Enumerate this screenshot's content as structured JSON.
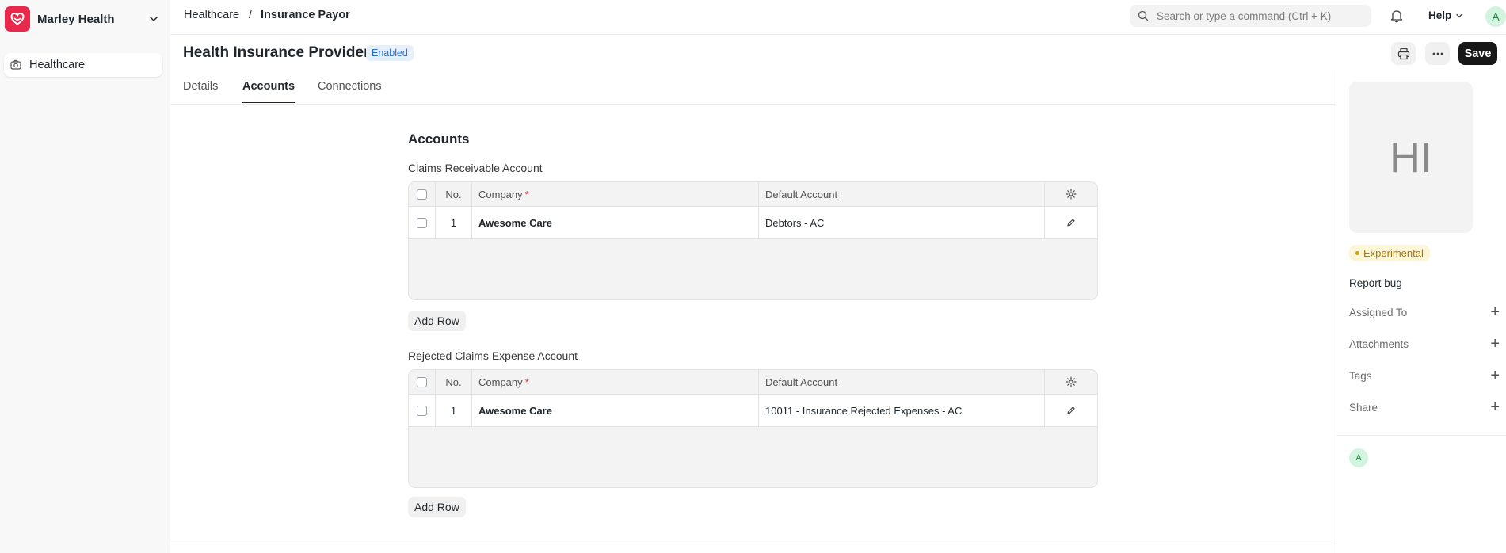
{
  "sidebar": {
    "brand_name": "Marley Health",
    "items": [
      {
        "label": "Healthcare"
      }
    ]
  },
  "topbar": {
    "breadcrumbs": [
      "Healthcare",
      "/",
      "Insurance Payor"
    ],
    "search_placeholder": "Search or type a command (Ctrl + K)",
    "help_label": "Help",
    "avatar_initial": "A"
  },
  "header": {
    "title": "Health Insurance Provider",
    "status": "Enabled",
    "save_label": "Save"
  },
  "tabs": [
    {
      "label": "Details",
      "active": false
    },
    {
      "label": "Accounts",
      "active": true
    },
    {
      "label": "Connections",
      "active": false
    }
  ],
  "section": {
    "title": "Accounts",
    "tables": [
      {
        "label": "Claims Receivable Account",
        "columns": {
          "no": "No.",
          "company": "Company",
          "required_mark": "*",
          "default": "Default Account"
        },
        "rows": [
          {
            "no": "1",
            "company": "Awesome Care",
            "default": "Debtors - AC"
          }
        ],
        "add_row_label": "Add Row"
      },
      {
        "label": "Rejected Claims Expense Account",
        "columns": {
          "no": "No.",
          "company": "Company",
          "required_mark": "*",
          "default": "Default Account"
        },
        "rows": [
          {
            "no": "1",
            "company": "Awesome Care",
            "default": "10011 - Insurance Rejected Expenses - AC"
          }
        ],
        "add_row_label": "Add Row"
      }
    ]
  },
  "right_panel": {
    "image_initials": "HI",
    "badge": "Experimental",
    "report_bug": "Report bug",
    "rows": [
      {
        "label": "Assigned To"
      },
      {
        "label": "Attachments"
      },
      {
        "label": "Tags"
      },
      {
        "label": "Share"
      }
    ],
    "avatar_initial": "A"
  },
  "colors": {
    "brand": "#e8294c",
    "save_button": "#171717",
    "enabled_badge": "#2c6ecf",
    "experimental_badge": "#a5770d"
  }
}
